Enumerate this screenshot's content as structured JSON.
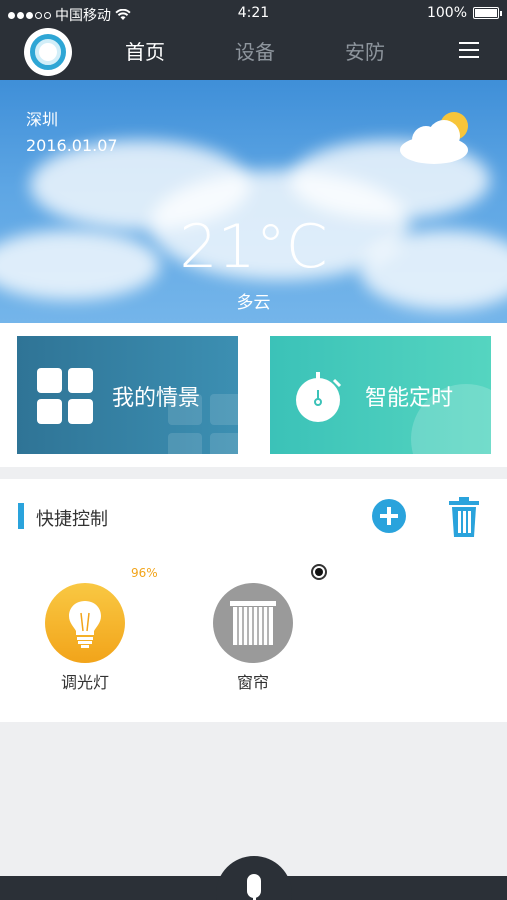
{
  "status_bar": {
    "carrier": "中国移动",
    "time": "4:21",
    "battery": "100%"
  },
  "nav": {
    "tabs": [
      {
        "label": "首页",
        "active": true
      },
      {
        "label": "设备",
        "active": false
      },
      {
        "label": "安防",
        "active": false
      }
    ],
    "menu_icon": "menu-icon"
  },
  "weather": {
    "city": "深圳",
    "date": "2016.01.07",
    "temperature": "21°C",
    "condition": "多云",
    "icon": "partly-cloudy-icon"
  },
  "cards": {
    "scene_label": "我的情景",
    "timer_label": "智能定时"
  },
  "quick_control": {
    "title": "快捷控制",
    "devices": [
      {
        "name": "调光灯",
        "icon": "bulb-icon",
        "level": "96%",
        "color": "#f2a41a"
      },
      {
        "name": "窗帘",
        "icon": "curtain-icon",
        "color": "#9a9a9a"
      }
    ]
  },
  "colors": {
    "nav_bg": "#2b3037",
    "accent": "#2aa3dc",
    "scene_card": "#2f7496",
    "timer_card": "#3bc2b8"
  }
}
